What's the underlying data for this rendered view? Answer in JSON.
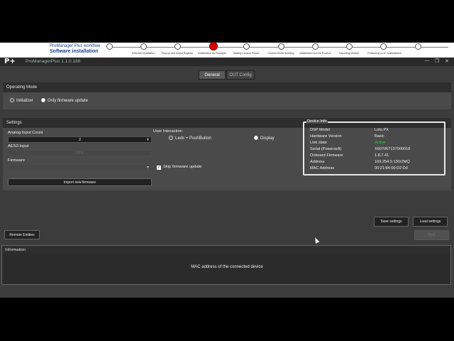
{
  "workflow": {
    "title_line1": "ProManager Plus workflow",
    "title_line2": "Software installation",
    "steps": [
      "Software Installation",
      "Sing-up and Brand Register",
      "Initialization as Prototype",
      "Making Custom Preset",
      "Custom Model Building",
      "Initialization as End Product",
      "Exporting Models",
      "Publishing on A+ Marketplace"
    ],
    "active_step": 2
  },
  "app": {
    "logo": "P+",
    "title": "ProManagerPlus 1.1.0.168",
    "win_minimize": "—",
    "win_restore": "❐",
    "win_close": "✕"
  },
  "tabs": {
    "general": "General",
    "out_config": "OUT Config"
  },
  "operating_mode": {
    "header": "Operating Mode",
    "initializer": "Initializer",
    "only_firmware": "Only firmware update",
    "selected": "initializer"
  },
  "settings": {
    "header": "Settings",
    "analog_input_count_label": "Analog Input Count",
    "analog_input_count_value": "2",
    "aes3_label": "AES3 Input",
    "aes3_value": "OFF",
    "firmware_label": "Firmware",
    "firmware_value": "",
    "import_firmware_btn": "Import new firmware",
    "user_interaction_label": "User Interaction",
    "leds_pushbutton": "Leds + PushButton",
    "display": "Display",
    "skip_firmware": "Skip firmware update",
    "skip_firmware_checked": "✓"
  },
  "device_info": {
    "title": "Device Info",
    "rows": [
      {
        "key": "DSP Model",
        "value": "Loto.PX"
      },
      {
        "key": "Hardware Version",
        "value": "Basic"
      },
      {
        "key": "Link state",
        "value": "Active"
      },
      {
        "key": "Serial (Powersoft)",
        "value": "X607067137000018"
      },
      {
        "key": "Onboard Firmware",
        "value": "1.8.7.41"
      },
      {
        "key": "Address",
        "value": "169.254.9.130/ZMQ"
      },
      {
        "key": "MAC Address",
        "value": "00:21:84:00:D2:D0"
      }
    ],
    "active_color": "#2ecc40"
  },
  "actions": {
    "save_settings": "Save settings",
    "load_settings": "Load settings",
    "remote_entities": "Remote Entities",
    "next": "Next"
  },
  "information": {
    "header": "Information",
    "message": "MAC address of the connected device"
  }
}
